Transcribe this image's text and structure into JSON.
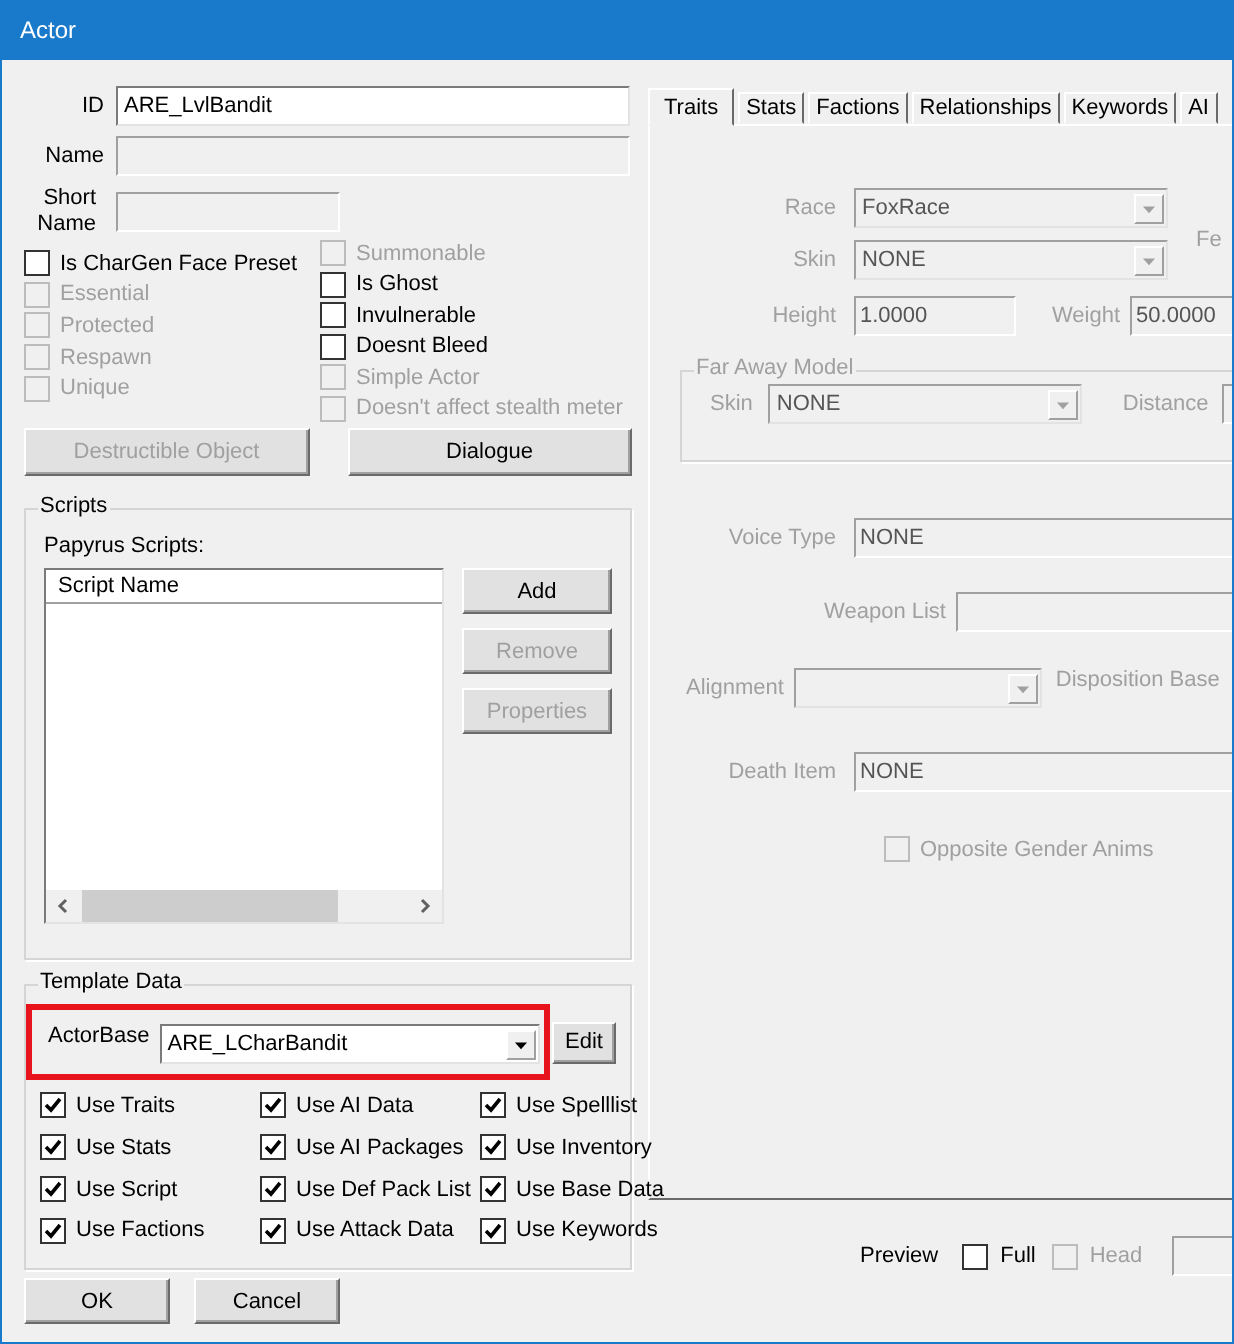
{
  "window": {
    "title": "Actor"
  },
  "id": {
    "label": "ID",
    "value": "ARE_LvlBandit"
  },
  "name": {
    "label": "Name",
    "disabled": true
  },
  "short_name": {
    "label": "Short Name",
    "disabled": true
  },
  "flags_left": [
    {
      "label": "Is CharGen Face Preset",
      "checked": false,
      "disabled": false
    },
    {
      "label": "Essential",
      "checked": false,
      "disabled": true
    },
    {
      "label": "Protected",
      "checked": false,
      "disabled": true
    },
    {
      "label": "Respawn",
      "checked": false,
      "disabled": true
    },
    {
      "label": "Unique",
      "checked": false,
      "disabled": true
    }
  ],
  "flags_right": [
    {
      "label": "Summonable",
      "checked": false,
      "disabled": true
    },
    {
      "label": "Is Ghost",
      "checked": false,
      "disabled": false
    },
    {
      "label": "Invulnerable",
      "checked": false,
      "disabled": false
    },
    {
      "label": "Doesnt Bleed",
      "checked": false,
      "disabled": false
    },
    {
      "label": "Simple Actor",
      "checked": false,
      "disabled": true
    },
    {
      "label": "Doesn't affect stealth meter",
      "checked": false,
      "disabled": true
    }
  ],
  "actions": [
    {
      "label": "Destructible Object",
      "disabled": true
    },
    {
      "label": "Dialogue",
      "disabled": false
    }
  ],
  "scripts": {
    "title": "Scripts",
    "list_label": "Papyrus Scripts:",
    "column": "Script Name",
    "buttons": [
      {
        "label": "Add",
        "disabled": false
      },
      {
        "label": "Remove",
        "disabled": true
      },
      {
        "label": "Properties",
        "disabled": true
      }
    ]
  },
  "template": {
    "title": "Template Data",
    "highlighted": true,
    "base_label": "ActorBase",
    "base_value": "ARE_LCharBandit",
    "edit": "Edit",
    "options": [
      {
        "label": "Use Traits",
        "checked": true
      },
      {
        "label": "Use AI Data",
        "checked": true
      },
      {
        "label": "Use Spelllist",
        "checked": true
      },
      {
        "label": "Use Stats",
        "checked": true
      },
      {
        "label": "Use AI Packages",
        "checked": true
      },
      {
        "label": "Use Inventory",
        "checked": true
      },
      {
        "label": "Use Script",
        "checked": true
      },
      {
        "label": "Use Def Pack List",
        "checked": true
      },
      {
        "label": "Use Base Data",
        "checked": true
      },
      {
        "label": "Use Factions",
        "checked": true
      },
      {
        "label": "Use Attack Data",
        "checked": true
      },
      {
        "label": "Use Keywords",
        "checked": true
      }
    ]
  },
  "dialog_buttons": [
    "OK",
    "Cancel"
  ],
  "tabs": [
    {
      "label": "Traits",
      "selected": true
    },
    {
      "label": "Stats",
      "selected": false
    },
    {
      "label": "Factions",
      "selected": false
    },
    {
      "label": "Relationships",
      "selected": false
    },
    {
      "label": "Keywords",
      "selected": false
    },
    {
      "label": "AI",
      "selected": false
    }
  ],
  "traits": {
    "disabled": true,
    "race": {
      "label": "Race",
      "value": "FoxRace"
    },
    "fe_label": "Fe",
    "skin": {
      "label": "Skin",
      "value": "NONE"
    },
    "height": {
      "label": "Height",
      "value": "1.0000"
    },
    "weight": {
      "label": "Weight",
      "value": "50.0000"
    },
    "far_away": {
      "title": "Far Away Model",
      "skin": {
        "label": "Skin",
        "value": "NONE"
      },
      "distance_label": "Distance"
    },
    "voice_type": {
      "label": "Voice Type",
      "value": "NONE"
    },
    "weapon_list": {
      "label": "Weapon List"
    },
    "alignment": {
      "label": "Alignment"
    },
    "disposition_label": "Disposition Base",
    "death_item": {
      "label": "Death Item",
      "value": "NONE"
    },
    "opposite_gender": {
      "label": "Opposite Gender Anims",
      "checked": false,
      "disabled": true
    }
  },
  "preview": {
    "label": "Preview",
    "options": [
      {
        "label": "Full",
        "checked": false,
        "disabled": false
      },
      {
        "label": "Head",
        "checked": false,
        "disabled": true
      }
    ]
  }
}
